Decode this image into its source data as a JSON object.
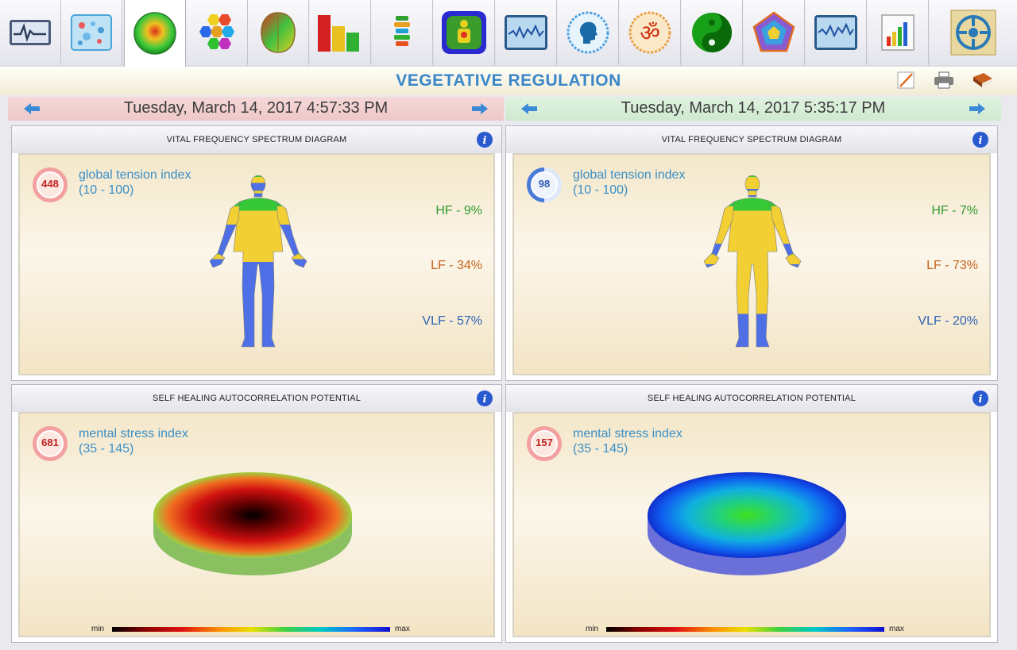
{
  "toolbar": {
    "buttons": [
      {
        "name": "ecg-monitor-icon"
      },
      {
        "name": "cell-analysis-icon"
      },
      {
        "name": "energy-sphere-icon"
      },
      {
        "name": "hexagon-organs-icon"
      },
      {
        "name": "brain-map-icon"
      },
      {
        "name": "bar-chart-icon"
      },
      {
        "name": "spine-icon"
      },
      {
        "name": "body-scan-icon"
      },
      {
        "name": "wave-chart-icon"
      },
      {
        "name": "head-profile-icon"
      },
      {
        "name": "om-symbol-icon"
      },
      {
        "name": "yin-yang-icon"
      },
      {
        "name": "pentagon-chart-icon"
      },
      {
        "name": "wave-chart-2-icon"
      },
      {
        "name": "bar-report-icon"
      },
      {
        "name": "logo-icon"
      }
    ],
    "active_index": 2
  },
  "header": {
    "title": "VEGETATIVE REGULATION"
  },
  "sessions": [
    {
      "date": "Tuesday, March 14, 2017 4:57:33 PM",
      "vital": {
        "title": "VITAL FREQUENCY SPECTRUM DIAGRAM",
        "index_value": "448",
        "index_name": "global tension index",
        "index_range": "(10 - 100)",
        "hf": "HF - 9%",
        "lf": "LF - 34%",
        "vlf": "VLF - 57%",
        "hf_percent": 9,
        "lf_percent": 34,
        "vlf_percent": 57,
        "badge_style": "red"
      },
      "healing": {
        "title": "SELF HEALING AUTOCORRELATION POTENTIAL",
        "index_value": "681",
        "index_name": "mental stress index",
        "index_range": "(35 - 145)",
        "scale_min": "min",
        "scale_max": "max",
        "disc_palette": "red"
      }
    },
    {
      "date": "Tuesday, March 14, 2017 5:35:17 PM",
      "vital": {
        "title": "VITAL FREQUENCY SPECTRUM DIAGRAM",
        "index_value": "98",
        "index_name": "global tension index",
        "index_range": "(10 - 100)",
        "hf": "HF - 7%",
        "lf": "LF - 73%",
        "vlf": "VLF - 20%",
        "hf_percent": 7,
        "lf_percent": 73,
        "vlf_percent": 20,
        "badge_style": "blue"
      },
      "healing": {
        "title": "SELF HEALING AUTOCORRELATION POTENTIAL",
        "index_value": "157",
        "index_name": "mental stress index",
        "index_range": "(35 - 145)",
        "scale_min": "min",
        "scale_max": "max",
        "disc_palette": "blue"
      }
    }
  ],
  "colors": {
    "title": "#3a86c8",
    "hf": "#2f9a2f",
    "lf": "#c8641e",
    "vlf": "#2e62b6",
    "body_head": "#37c837",
    "body_upper": "#f2d033",
    "body_lower": "#4f6fe6",
    "badge_red": "#e86a6a",
    "badge_blue": "#2e62b6"
  }
}
